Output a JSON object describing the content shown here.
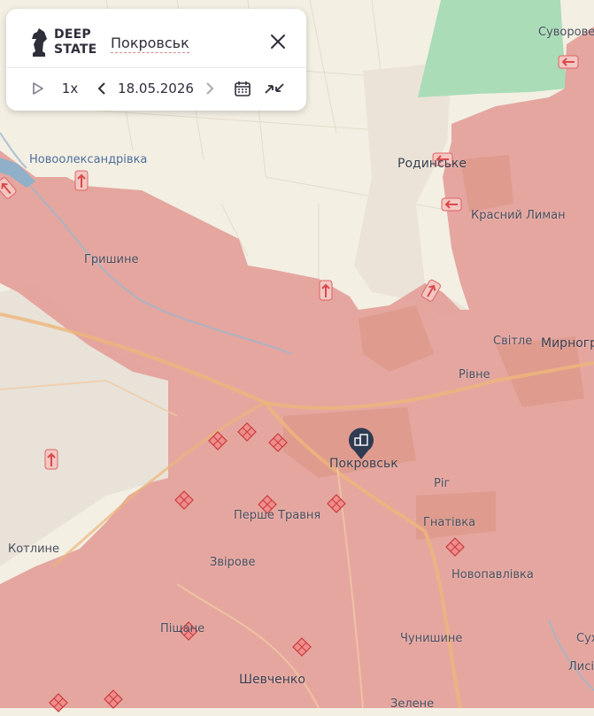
{
  "app": {
    "brand_line1": "DEEP",
    "brand_line2": "STATE"
  },
  "search": {
    "value": "Покровськ"
  },
  "timeline": {
    "speed": "1x",
    "date": "18.05.2026"
  },
  "colors": {
    "occupied": "#e4a09a",
    "background": "#f3efe3",
    "grey_zone": "#e7ddd0",
    "forest": "#a8dcb6",
    "accent_red": "#e06363",
    "marker_dark": "#2f3b52"
  },
  "places": [
    {
      "id": "suvorove",
      "label": "Суворове"
    },
    {
      "id": "novooleksandrivka",
      "label": "Новоолександрівка"
    },
    {
      "id": "rodynske",
      "label": "Родинське"
    },
    {
      "id": "krasnyi-lyman",
      "label": "Красний Лиман"
    },
    {
      "id": "hryshyne",
      "label": "Гришине"
    },
    {
      "id": "svitle",
      "label": "Світле"
    },
    {
      "id": "myrnohrad",
      "label": "Мирногр"
    },
    {
      "id": "rivne",
      "label": "Рівне"
    },
    {
      "id": "pokrovsk",
      "label": "Покровськ"
    },
    {
      "id": "rih",
      "label": "Ріг"
    },
    {
      "id": "pershe-travnia",
      "label": "Перше Травня"
    },
    {
      "id": "hnativka",
      "label": "Гнатівка"
    },
    {
      "id": "kotlyne",
      "label": "Котлине"
    },
    {
      "id": "zvirove",
      "label": "Звірове"
    },
    {
      "id": "novopavlivka",
      "label": "Новопавлівка"
    },
    {
      "id": "pishchane",
      "label": "Піщане"
    },
    {
      "id": "chunyshyne",
      "label": "Чунишине"
    },
    {
      "id": "sukh",
      "label": "Сух"
    },
    {
      "id": "lysi",
      "label": "Лисі"
    },
    {
      "id": "shevchenko",
      "label": "Шевченко"
    },
    {
      "id": "zelene",
      "label": "Зелене"
    }
  ],
  "icons": {
    "logo": "knight-chess-icon",
    "close": "close-icon",
    "play": "play-icon",
    "prev": "chevron-left-icon",
    "next": "chevron-right-icon",
    "calendar": "calendar-icon",
    "compare": "compress-arrows-icon",
    "city_marker": "city-marker-icon",
    "advance_arrow": "advance-arrow-icon",
    "strike": "strike-diamond-icon"
  }
}
